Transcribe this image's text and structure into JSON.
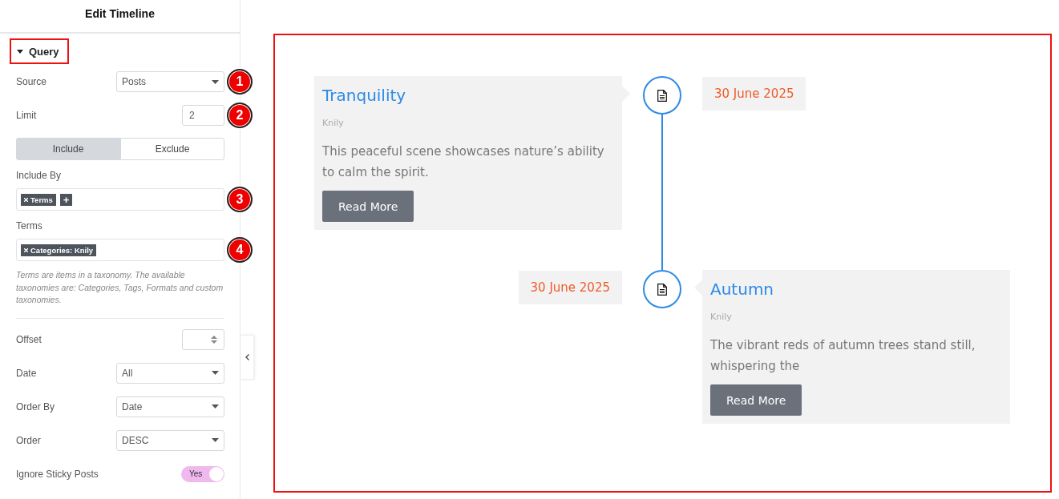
{
  "panel": {
    "title": "Edit Timeline",
    "section": {
      "label": "Query",
      "expanded": true
    },
    "controls": [
      {
        "kind": "select",
        "label": "Source",
        "value": "Posts",
        "badge": "1"
      },
      {
        "kind": "number",
        "label": "Limit",
        "value": "2",
        "badge": "2"
      },
      {
        "kind": "segmented",
        "options": [
          {
            "label": "Include",
            "selected": true
          },
          {
            "label": "Exclude",
            "selected": false
          }
        ]
      },
      {
        "kind": "tags",
        "label": "Include By",
        "tags": [
          "Terms"
        ],
        "add_label": "+",
        "badge": "3"
      },
      {
        "kind": "tags",
        "label": "Terms",
        "tags": [
          "Categories: Knily"
        ],
        "badge": "4"
      },
      {
        "kind": "note",
        "text": "Terms are items in a taxonomy. The available taxonomies are: Categories, Tags, Formats and custom taxonomies."
      },
      {
        "kind": "divider"
      },
      {
        "kind": "spinner",
        "label": "Offset"
      },
      {
        "kind": "select",
        "label": "Date",
        "value": "All"
      },
      {
        "kind": "select",
        "label": "Order By",
        "value": "Date"
      },
      {
        "kind": "select",
        "label": "Order",
        "value": "DESC"
      },
      {
        "kind": "toggle",
        "label": "Ignore Sticky Posts",
        "on": true,
        "state_text": "Yes"
      }
    ]
  },
  "timeline": {
    "items": [
      {
        "kind": "left",
        "title": "Tranquility",
        "author": "Knily",
        "excerpt": "This peaceful scene showcases nature’s ability to calm the spirit.",
        "button": "Read More",
        "date": "30 June 2025"
      },
      {
        "kind": "right",
        "title": "Autumn",
        "author": "Knily",
        "excerpt": "The vibrant reds of autumn trees stand still, whispering the",
        "button": "Read More",
        "date": "30 June 2025"
      }
    ]
  }
}
